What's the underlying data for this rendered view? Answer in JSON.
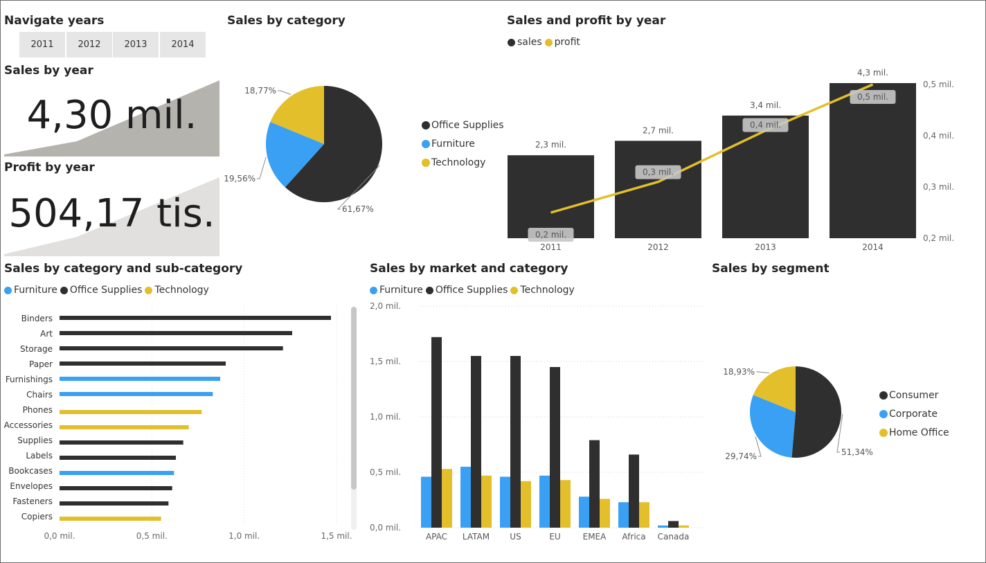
{
  "colors": {
    "dark": "#2f2f2f",
    "blue": "#3aa0f3",
    "yellow": "#e3bf2c",
    "slicer": "#e6e6e6",
    "card_bg": "#b5b3ae"
  },
  "slicer": {
    "title": "Navigate years",
    "years": [
      "2011",
      "2012",
      "2013",
      "2014"
    ]
  },
  "cards": {
    "sales": {
      "title": "Sales by year",
      "value": "4,30 mil."
    },
    "profit": {
      "title": "Profit by year",
      "value": "504,17 tis."
    }
  },
  "titles": {
    "pie_category": "Sales by category",
    "combo": "Sales and profit by year",
    "subcat": "Sales by category and sub-category",
    "market": "Sales by market and category",
    "segment": "Sales by segment"
  },
  "chart_data": [
    {
      "id": "pie_category",
      "type": "pie",
      "title": "Sales by category",
      "slices": [
        {
          "name": "Office Supplies",
          "value": 61.67,
          "label": "61,67%",
          "color": "#2f2f2f"
        },
        {
          "name": "Furniture",
          "value": 19.56,
          "label": "19,56%",
          "color": "#3aa0f3"
        },
        {
          "name": "Technology",
          "value": 18.77,
          "label": "18,77%",
          "color": "#e3bf2c"
        }
      ],
      "legend": "right"
    },
    {
      "id": "combo",
      "type": "bar",
      "title": "Sales and profit by year",
      "categories": [
        "2011",
        "2012",
        "2013",
        "2014"
      ],
      "series": [
        {
          "name": "sales",
          "type": "bar",
          "values": [
            2.3,
            2.7,
            3.4,
            4.3
          ],
          "labels": [
            "2,3 mil.",
            "2,7 mil.",
            "3,4 mil.",
            "4,3 mil."
          ],
          "color": "#2f2f2f"
        },
        {
          "name": "profit",
          "type": "line",
          "values": [
            0.25,
            0.31,
            0.41,
            0.5
          ],
          "labels": [
            "0,2 mil.",
            "0,3 mil.",
            "0,4 mil.",
            "0,5 mil."
          ],
          "color": "#e3bf2c"
        }
      ],
      "y_sales_lim": [
        0,
        4.3
      ],
      "y_profit_lim": [
        0.2,
        0.5
      ],
      "y_profit_ticks": [
        "0,2 mil.",
        "0,3 mil.",
        "0,4 mil.",
        "0,5 mil."
      ],
      "legend": "top-left"
    },
    {
      "id": "subcat",
      "type": "bar",
      "title": "Sales by category and sub-category",
      "orientation": "horizontal",
      "categories": [
        "Binders",
        "Art",
        "Storage",
        "Paper",
        "Furnishings",
        "Chairs",
        "Phones",
        "Accessories",
        "Supplies",
        "Labels",
        "Bookcases",
        "Envelopes",
        "Fasteners",
        "Copiers"
      ],
      "values": [
        1.47,
        1.26,
        1.21,
        0.9,
        0.87,
        0.83,
        0.77,
        0.7,
        0.67,
        0.63,
        0.62,
        0.61,
        0.59,
        0.55
      ],
      "category_of_bar": [
        "Office Supplies",
        "Office Supplies",
        "Office Supplies",
        "Office Supplies",
        "Furniture",
        "Furniture",
        "Technology",
        "Technology",
        "Office Supplies",
        "Office Supplies",
        "Furniture",
        "Office Supplies",
        "Office Supplies",
        "Technology"
      ],
      "series_names": [
        "Furniture",
        "Office Supplies",
        "Technology"
      ],
      "xlim": [
        0,
        1.5
      ],
      "x_ticks": [
        "0,0 mil.",
        "0,5 mil.",
        "1,0 mil.",
        "1,5 mil."
      ],
      "legend": "top-left"
    },
    {
      "id": "market",
      "type": "bar",
      "title": "Sales by market and category",
      "categories": [
        "APAC",
        "LATAM",
        "US",
        "EU",
        "EMEA",
        "Africa",
        "Canada"
      ],
      "series": [
        {
          "name": "Furniture",
          "values": [
            0.46,
            0.55,
            0.46,
            0.47,
            0.28,
            0.23,
            0.02
          ],
          "color": "#3aa0f3"
        },
        {
          "name": "Office Supplies",
          "values": [
            1.72,
            1.55,
            1.55,
            1.45,
            0.79,
            0.66,
            0.06
          ],
          "color": "#2f2f2f"
        },
        {
          "name": "Technology",
          "values": [
            0.53,
            0.47,
            0.42,
            0.43,
            0.26,
            0.23,
            0.02
          ],
          "color": "#e3bf2c"
        }
      ],
      "ylim": [
        0,
        2.0
      ],
      "y_ticks": [
        "0,0 mil.",
        "0,5 mil.",
        "1,0 mil.",
        "1,5 mil.",
        "2,0 mil."
      ],
      "legend": "top-left"
    },
    {
      "id": "segment",
      "type": "pie",
      "title": "Sales by segment",
      "slices": [
        {
          "name": "Consumer",
          "value": 51.34,
          "label": "51,34%",
          "color": "#2f2f2f"
        },
        {
          "name": "Corporate",
          "value": 29.74,
          "label": "29,74%",
          "color": "#3aa0f3"
        },
        {
          "name": "Home Office",
          "value": 18.93,
          "label": "18,93%",
          "color": "#e3bf2c"
        }
      ],
      "legend": "right"
    }
  ]
}
